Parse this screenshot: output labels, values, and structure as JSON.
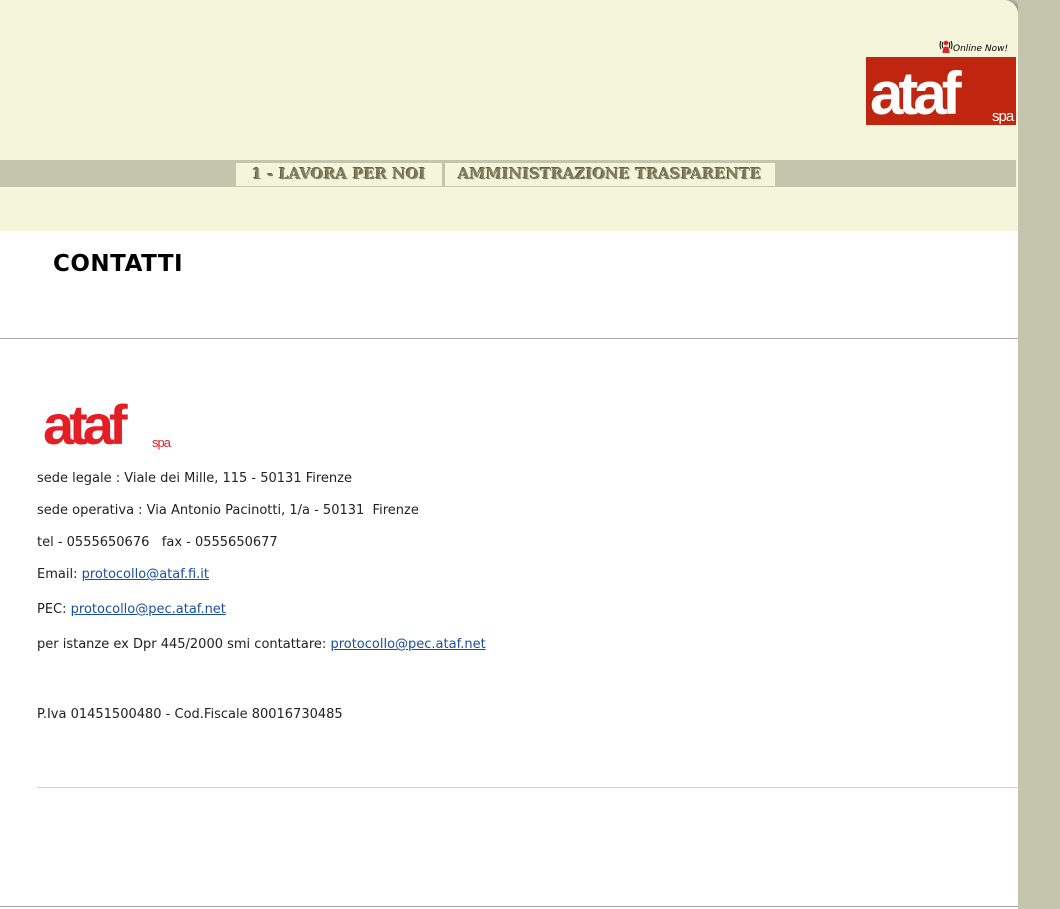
{
  "header": {
    "online_label": "Online Now!",
    "logo_text": "ataf",
    "logo_suffix": "spa",
    "logo_color": "#c0260f"
  },
  "nav": {
    "items": [
      {
        "label": "1 - LAVORA PER NOI"
      },
      {
        "label": "AMMINISTRAZIONE TRASPARENTE"
      }
    ]
  },
  "main": {
    "title": "CONTATTI",
    "brand_color": "#e31e24",
    "sede_legale": "sede legale : Viale dei Mille, 115 - 50131 Firenze",
    "sede_operativa": "sede operativa : Via Antonio Pacinotti, 1/a - 50131  Firenze",
    "phones": "tel - 0555650676   fax - 0555650677",
    "email_label": "Email: ",
    "email": "protocollo@ataf.fi.it",
    "pec_label": "PEC: ",
    "pec": "protocollo@pec.ataf.net",
    "istanze_label": "per istanze ex Dpr 445/2000 smi contattare: ",
    "istanze_email": "protocollo@pec.ataf.net",
    "fiscal": "P.Iva 01451500480 - Cod.Fiscale 80016730485"
  }
}
